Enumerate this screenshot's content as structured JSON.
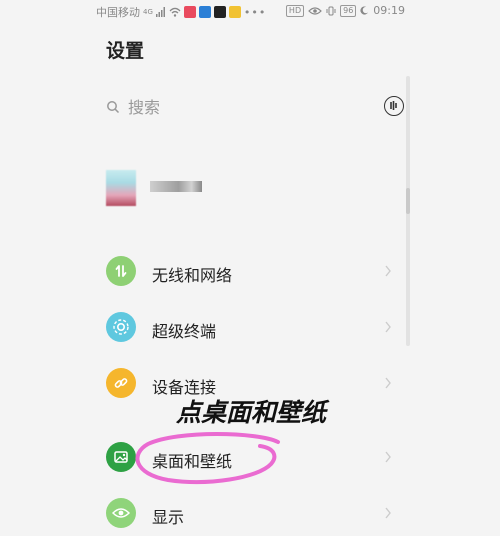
{
  "status_bar": {
    "carrier": "中国移动",
    "network": "4G",
    "battery": "96",
    "time": "09:19"
  },
  "header": {
    "title": "设置"
  },
  "search": {
    "placeholder": "搜索"
  },
  "menu": {
    "items": [
      {
        "label": "无线和网络",
        "color": "#8ed074",
        "icon": "wireless-icon"
      },
      {
        "label": "超级终端",
        "color": "#5fc8df",
        "icon": "super-device-icon"
      },
      {
        "label": "设备连接",
        "color": "#f5b62d",
        "icon": "link-icon"
      },
      {
        "label": "桌面和壁纸",
        "color": "#2ea144",
        "icon": "wallpaper-icon"
      },
      {
        "label": "显示",
        "color": "#8fd47a",
        "icon": "display-eye-icon"
      }
    ]
  },
  "annotation": {
    "text": "点桌面和壁纸",
    "circle_color": "#ea6bd1"
  }
}
